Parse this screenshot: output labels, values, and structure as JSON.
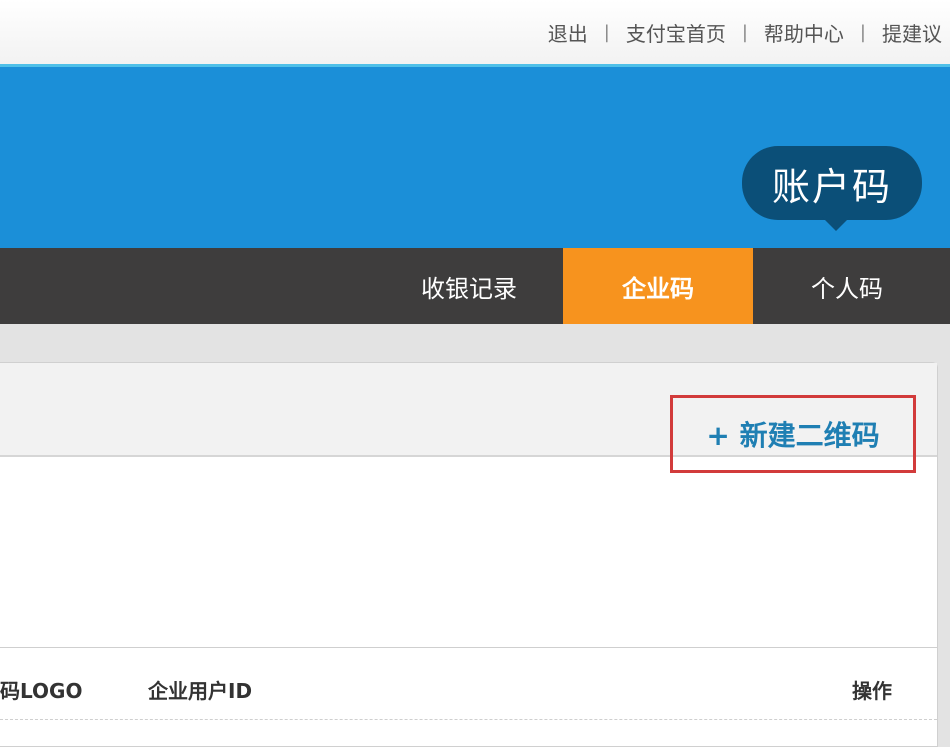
{
  "top_links": {
    "logout": "退出",
    "alipay_home": "支付宝首页",
    "help_center": "帮助中心",
    "feedback": "提建议",
    "separator": "|"
  },
  "banner": {
    "badge": "账户码",
    "background_color": "#1b8fd8",
    "badge_color": "#0b4f78"
  },
  "nav": {
    "tabs": [
      {
        "label": "收银记录",
        "active": false
      },
      {
        "label": "企业码",
        "active": true
      },
      {
        "label": "个人码",
        "active": false
      }
    ],
    "active_color": "#f7931e"
  },
  "toolbar": {
    "new_qr_label": "+ 新建二维码",
    "highlight_color": "#d23b3b"
  },
  "table": {
    "columns": [
      "码LOGO",
      "企业用户ID",
      "操作"
    ]
  }
}
